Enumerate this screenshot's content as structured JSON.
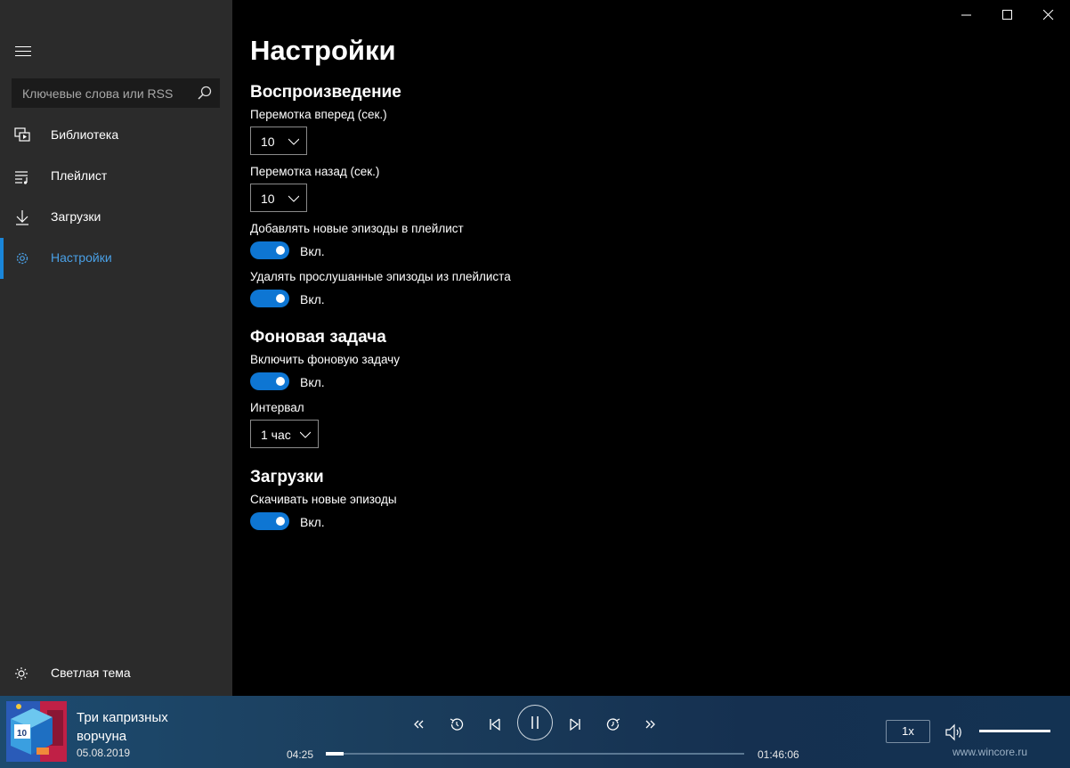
{
  "window": {
    "minimize_icon": "minimize-icon",
    "maximize_icon": "maximize-icon",
    "close_icon": "close-icon"
  },
  "sidebar": {
    "search": {
      "placeholder": "Ключевые слова или RSS"
    },
    "items": [
      {
        "label": "Библиотека",
        "icon": "library-icon"
      },
      {
        "label": "Плейлист",
        "icon": "playlist-icon"
      },
      {
        "label": "Загрузки",
        "icon": "download-icon"
      },
      {
        "label": "Настройки",
        "icon": "gear-icon",
        "active": true
      }
    ],
    "theme": {
      "label": "Светлая тема",
      "icon": "sun-icon"
    }
  },
  "settings": {
    "title": "Настройки",
    "playback": {
      "title": "Воспроизведение",
      "forward": {
        "label": "Перемотка вперед (сек.)",
        "value": "10"
      },
      "backward": {
        "label": "Перемотка назад (сек.)",
        "value": "10"
      },
      "add_new": {
        "label": "Добавлять новые эпизоды в плейлист",
        "state": "Вкл."
      },
      "remove_played": {
        "label": "Удалять прослушанные эпизоды из плейлиста",
        "state": "Вкл."
      }
    },
    "background": {
      "title": "Фоновая задача",
      "enable": {
        "label": "Включить фоновую задачу",
        "state": "Вкл."
      },
      "interval": {
        "label": "Интервал",
        "value": "1 час"
      }
    },
    "downloads": {
      "title": "Загрузки",
      "auto": {
        "label": "Скачивать новые эпизоды",
        "state": "Вкл."
      }
    }
  },
  "player": {
    "episode_title": "Три капризных ворчуна",
    "episode_date": "05.08.2019",
    "elapsed": "04:25",
    "duration": "01:46:06",
    "progress_fraction": 0.042,
    "speed": "1x",
    "volume_fraction": 1.0,
    "watermark": "www.wincore.ru",
    "accent": "#0e76d3"
  }
}
